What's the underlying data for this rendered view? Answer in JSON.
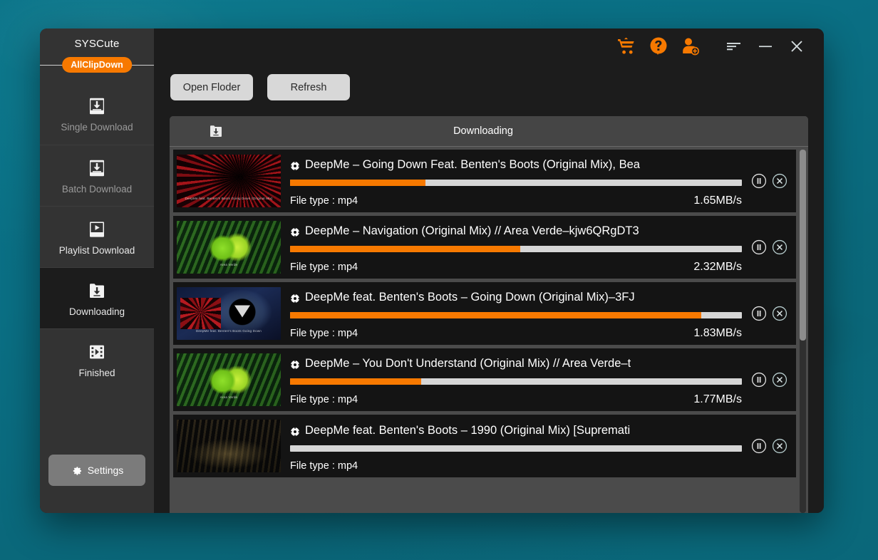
{
  "app": {
    "brand_title": "SYSCute",
    "brand_badge": "AllClipDown"
  },
  "sidebar": {
    "items": [
      {
        "label": "Single Download",
        "icon": "download-box-icon",
        "state": "dim"
      },
      {
        "label": "Batch Download",
        "icon": "download-box-icon",
        "state": "dim"
      },
      {
        "label": "Playlist Download",
        "icon": "playlist-play-icon",
        "state": "normal"
      },
      {
        "label": "Downloading",
        "icon": "download-folder-icon",
        "state": "active"
      },
      {
        "label": "Finished",
        "icon": "film-play-icon",
        "state": "normal"
      }
    ],
    "settings_label": "Settings"
  },
  "titlebar": {
    "icons": [
      {
        "name": "cart-icon",
        "title": "Store"
      },
      {
        "name": "help-icon",
        "title": "Help"
      },
      {
        "name": "user-add-icon",
        "title": "Account"
      },
      {
        "name": "menu-icon",
        "title": "Menu"
      },
      {
        "name": "minimize-icon",
        "title": "Minimize"
      },
      {
        "name": "close-icon",
        "title": "Close"
      }
    ]
  },
  "toolbar": {
    "open_folder_label": "Open Floder",
    "refresh_label": "Refresh"
  },
  "list": {
    "header_title": "Downloading",
    "header_icon": "download-folder-icon",
    "rows": [
      {
        "title": "DeepMe – Going Down Feat. Benten's Boots (Original Mix), Bea",
        "file_type": "File type : mp4",
        "speed": "1.65MB/s",
        "progress": 30,
        "thumb": "red-laser",
        "thumb_caption": "DeepMe feat. Benten's Boots\nGoing Down (Original Mix)"
      },
      {
        "title": "DeepMe – Navigation (Original Mix) // Area Verde–kjw6QRgDT3",
        "file_type": "File type : mp4",
        "speed": "2.32MB/s",
        "progress": 51,
        "thumb": "green-orb",
        "thumb_caption": "Area Verde"
      },
      {
        "title": "DeepMe feat. Benten's Boots – Going Down (Original Mix)–3FJ",
        "file_type": "File type : mp4",
        "speed": "1.83MB/s",
        "progress": 91,
        "thumb": "blue-triangle",
        "thumb_caption": "DeepMe feat. Benten's Boots\nGoing Down"
      },
      {
        "title": "DeepMe – You Don't Understand (Original Mix) // Area Verde–t",
        "file_type": "File type : mp4",
        "speed": "1.77MB/s",
        "progress": 29,
        "thumb": "green-orb",
        "thumb_caption": "Area Verde"
      },
      {
        "title": "DeepMe feat. Benten's Boots – 1990 (Original Mix) [Supremati",
        "file_type": "File type : mp4",
        "speed": "",
        "progress": 0,
        "thumb": "dark-gold",
        "thumb_caption": ""
      }
    ],
    "row_action_pause": "pause-button",
    "row_action_cancel": "cancel-button"
  },
  "colors": {
    "accent": "#f77900",
    "window_bg": "#1c1c1c",
    "sidebar_bg": "#333333",
    "panel_bg": "#4b4b4b",
    "row_bg": "#141414",
    "bar_track": "#d6d6d6",
    "desktop": "#0b7287"
  }
}
